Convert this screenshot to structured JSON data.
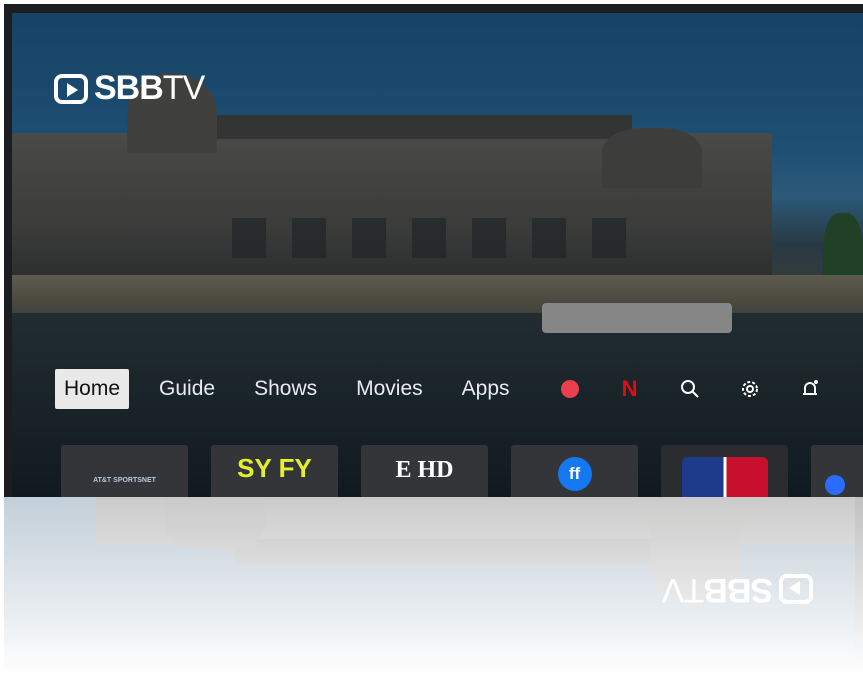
{
  "app": {
    "logo_main": "SBB",
    "logo_tv": "TV"
  },
  "nav": {
    "items": [
      {
        "label": "Home",
        "active": true
      },
      {
        "label": "Guide",
        "active": false
      },
      {
        "label": "Shows",
        "active": false
      },
      {
        "label": "Movies",
        "active": false
      },
      {
        "label": "Apps",
        "active": false
      }
    ],
    "icons": [
      "record-icon",
      "netflix-icon",
      "search-icon",
      "settings-icon",
      "notifications-icon"
    ],
    "netflix_letter": "N"
  },
  "tiles": [
    {
      "name": "att-sportsnet",
      "label": "AT&T SPORTSNET"
    },
    {
      "name": "syfy",
      "label": "SY FY"
    },
    {
      "name": "e-hd",
      "label": "E HD"
    },
    {
      "name": "freeform",
      "label": "ff"
    },
    {
      "name": "mlb",
      "label": ""
    },
    {
      "name": "app-partial",
      "label": ""
    }
  ],
  "colors": {
    "accent_record": "#e9404d",
    "netflix": "#e50914",
    "syfy": "#e3f02e",
    "freeform": "#1478f0"
  }
}
